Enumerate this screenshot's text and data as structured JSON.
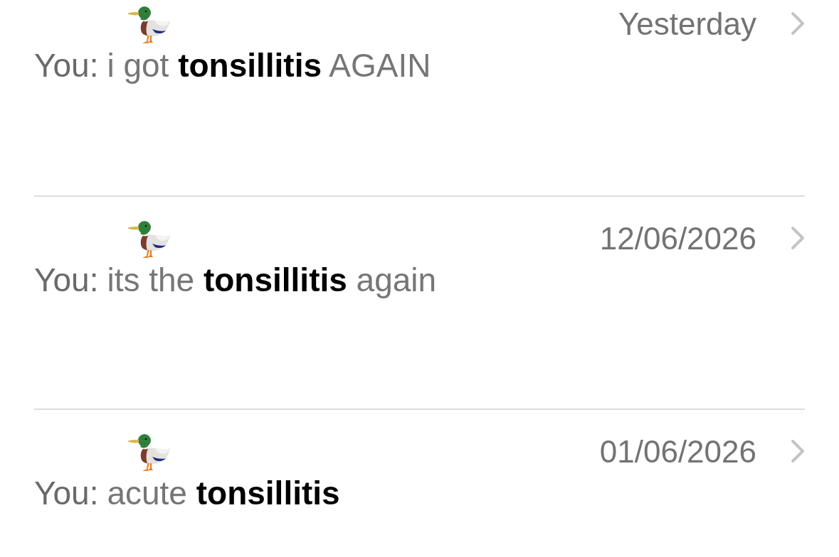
{
  "results": [
    {
      "sender": "You:",
      "text": "i got **tonsillitis** AGAIN",
      "date": "Yesterday"
    },
    {
      "sender": "You:",
      "text": "its the **tonsillitis** again",
      "date": "12/06/2026"
    },
    {
      "sender": "You:",
      "text": "acute **tonsillitis**",
      "date": "01/06/2026"
    }
  ]
}
